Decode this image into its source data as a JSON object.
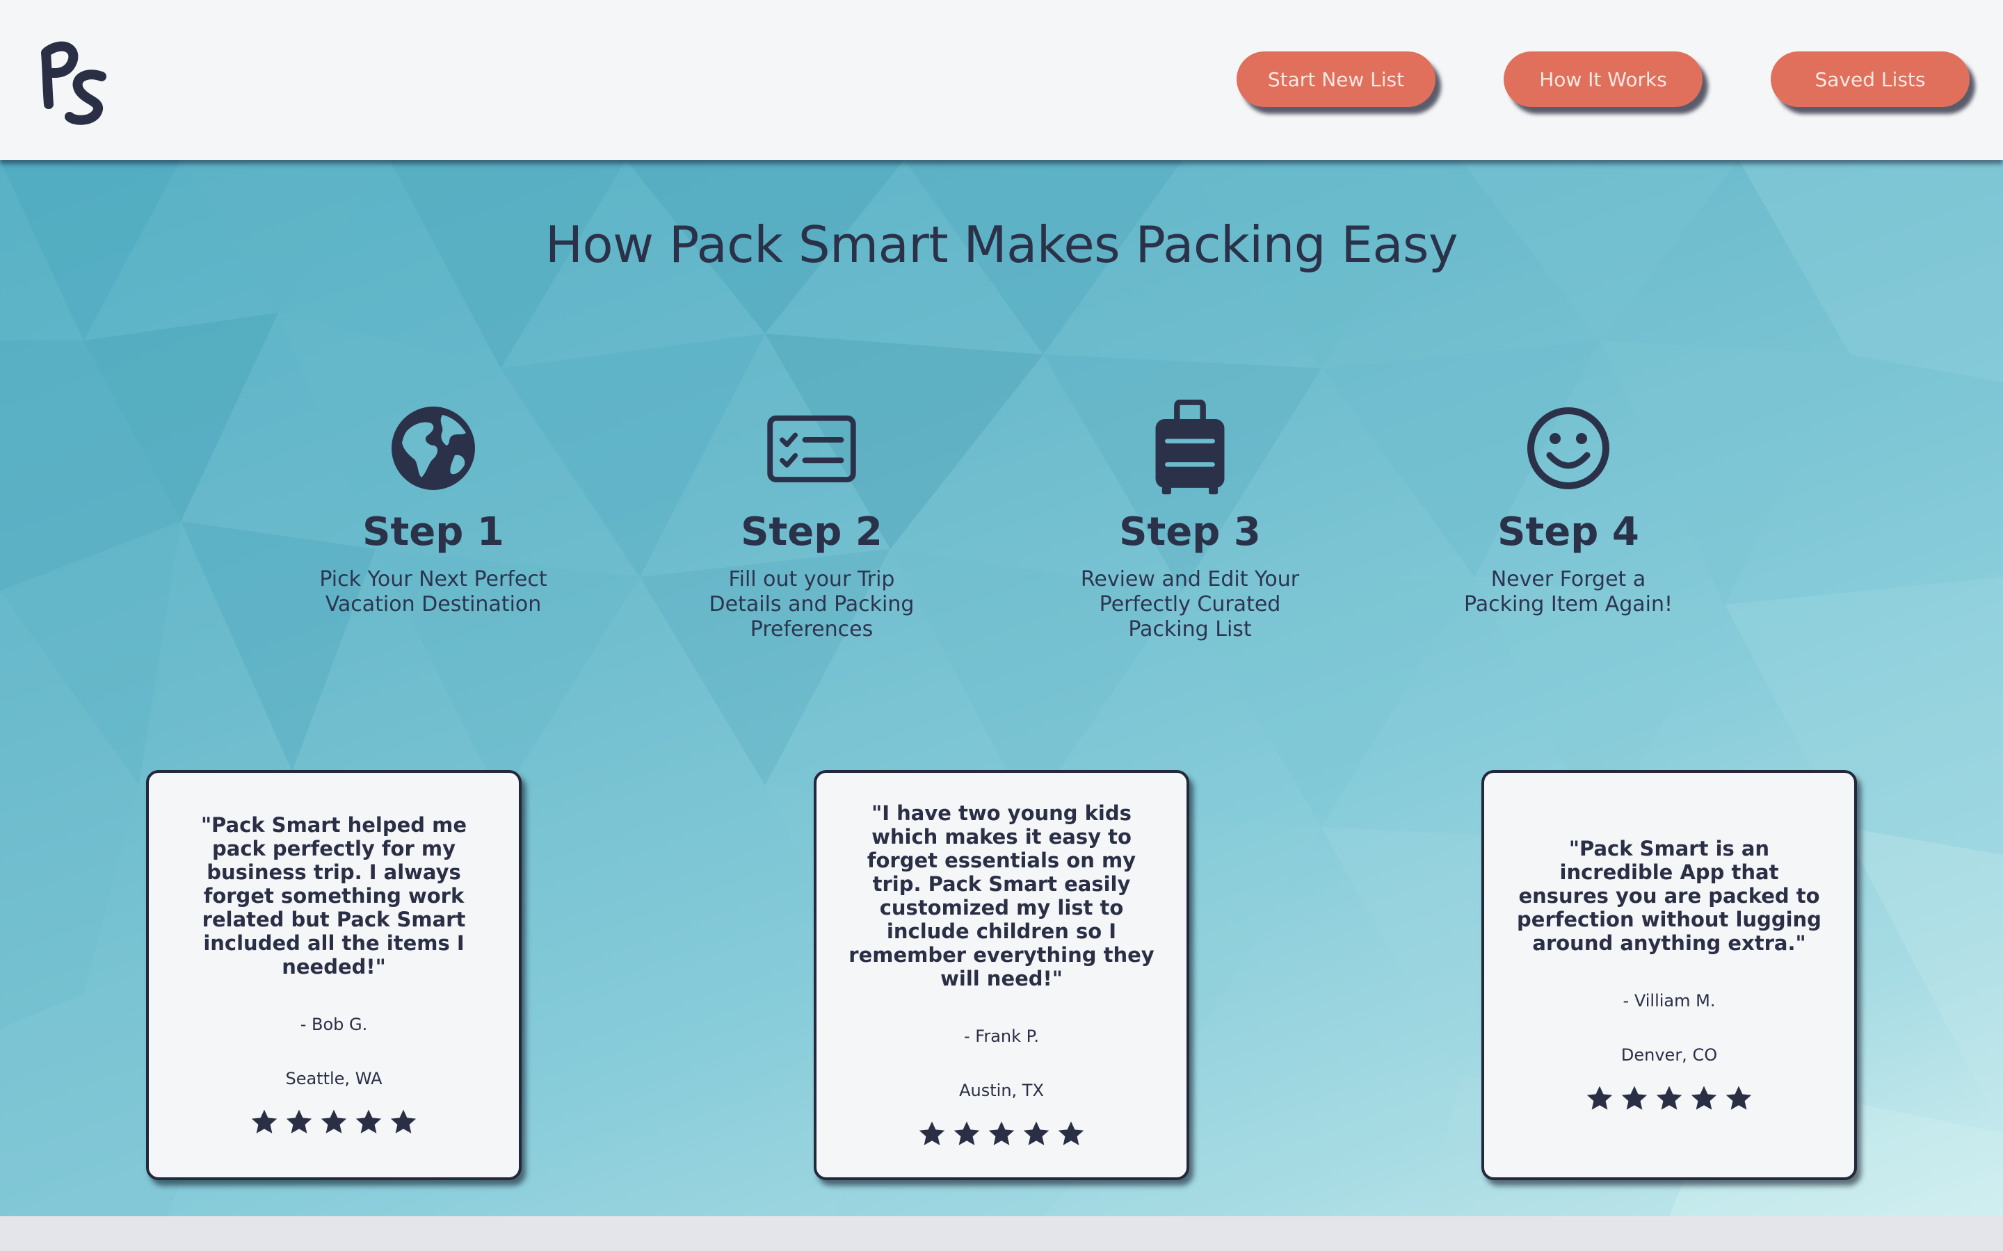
{
  "header": {
    "logo_text": "PS",
    "nav": [
      {
        "label": "Start New List"
      },
      {
        "label": "How It Works"
      },
      {
        "label": "Saved Lists"
      }
    ]
  },
  "hero": {
    "title": "How Pack Smart Makes Packing Easy"
  },
  "steps": [
    {
      "icon": "globe-icon",
      "title": "Step 1",
      "desc": "Pick Your Next Perfect Vacation Destination"
    },
    {
      "icon": "checklist-icon",
      "title": "Step 2",
      "desc": "Fill out your Trip Details and Packing Preferences"
    },
    {
      "icon": "suitcase-icon",
      "title": "Step 3",
      "desc": "Review and Edit Your Perfectly Curated Packing List"
    },
    {
      "icon": "smiley-icon",
      "title": "Step 4",
      "desc": "Never Forget a Packing Item Again!"
    }
  ],
  "testimonials": [
    {
      "quote": "\"Pack Smart helped me pack perfectly for my business trip. I always forget something work related but Pack Smart included all the items I needed!\"",
      "author": "- Bob G.",
      "location": "Seattle, WA",
      "rating": 5
    },
    {
      "quote": "\"I have two young kids which makes it easy to forget essentials on my trip. Pack Smart easily customized my list to include children so I remember everything they will need!\"",
      "author": "- Frank P.",
      "location": "Austin, TX",
      "rating": 5
    },
    {
      "quote": "\"Pack Smart is an incredible App that ensures you are packed to perfection without lugging around anything extra.\"",
      "author": "- Villiam M.",
      "location": "Denver, CO",
      "rating": 5
    }
  ],
  "colors": {
    "accent": "#e06f5b",
    "ink": "#2b3148",
    "background_teal": "#6dbccd"
  }
}
